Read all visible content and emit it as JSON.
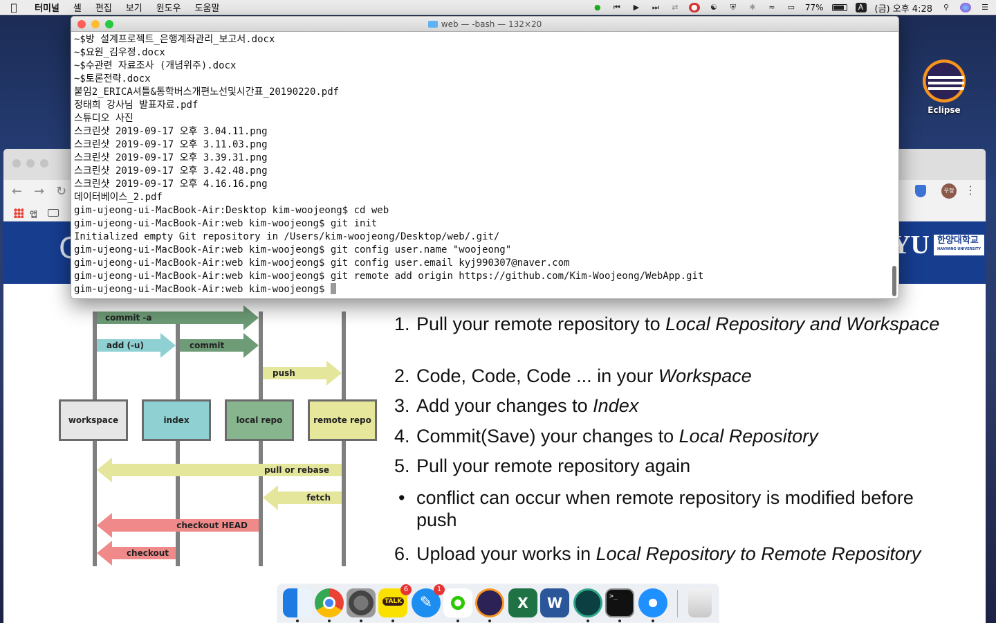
{
  "menubar": {
    "app_name": "터미널",
    "menus": [
      "셸",
      "편집",
      "보기",
      "윈도우",
      "도움말"
    ],
    "battery_percent": "77%",
    "input_source": "A",
    "clock": "(금) 오후 4:28"
  },
  "desktop": {
    "eclipse_label": "Eclipse"
  },
  "browser": {
    "bookmarks_apps_label": "앱",
    "avatar_text": "우정",
    "logo_letters": "YU",
    "logo_korean": "한양대학교",
    "logo_english": "HANYANG UNIVERSITY",
    "slide_title_fragment": "G"
  },
  "diagram": {
    "arrows": {
      "commit_a": "commit -a",
      "add_u": "add (-u)",
      "commit": "commit",
      "push": "push",
      "pull_or_rebase": "pull or rebase",
      "fetch": "fetch",
      "checkout_head": "checkout HEAD",
      "checkout": "checkout"
    },
    "boxes": {
      "workspace": "workspace",
      "index": "index",
      "local_repo": "local repo",
      "remote_repo": "remote repo"
    },
    "colors": {
      "workspace": "#e6e6e6",
      "index": "#8fd0d3",
      "local_repo": "#86b58e",
      "remote_repo": "#e6e79a",
      "green_arrow": "#6e9c77",
      "cyan_arrow": "#8fd0d3",
      "yellow_arrow": "#e4e69c",
      "red_arrow": "#f08a8a"
    }
  },
  "steps": [
    {
      "num": "1.",
      "plain": "Pull your remote repository to ",
      "italic": "Local Repository and Workspace"
    },
    {
      "num": "2.",
      "plain": "Code, Code, Code ... in your ",
      "italic": "Workspace"
    },
    {
      "num": "3.",
      "plain": "Add your changes to ",
      "italic": "Index"
    },
    {
      "num": "4.",
      "plain": "Commit(Save) your changes to ",
      "italic": "Local Repository"
    },
    {
      "num": "5.",
      "plain": "Pull your remote repository again",
      "italic": ""
    },
    {
      "num": "•",
      "plain": "conflict can occur when remote repository is modified before push",
      "italic": ""
    },
    {
      "num": "6.",
      "plain": "Upload your works in ",
      "italic": "Local Repository to Remote Repository"
    }
  ],
  "terminal": {
    "title": "web — -bash — 132×20",
    "lines": [
      "~$방 설계프로젝트_은행계좌관리_보고서.docx",
      "~$요원_김우정.docx",
      "~$수관련 자료조사 (개념위주).docx",
      "~$토론전략.docx",
      "붙임2_ERICA셔틀&통학버스개편노선및시간표_20190220.pdf",
      "정태희 강사님 발표자료.pdf",
      "스튜디오 사진",
      "스크린샷 2019-09-17 오후 3.04.11.png",
      "스크린샷 2019-09-17 오후 3.11.03.png",
      "스크린샷 2019-09-17 오후 3.39.31.png",
      "스크린샷 2019-09-17 오후 3.42.48.png",
      "스크린샷 2019-09-17 오후 4.16.16.png",
      "데이터베이스_2.pdf",
      "gim-ujeong-ui-MacBook-Air:Desktop kim-woojeong$ cd web",
      "gim-ujeong-ui-MacBook-Air:web kim-woojeong$ git init",
      "Initialized empty Git repository in /Users/kim-woojeong/Desktop/web/.git/",
      "gim-ujeong-ui-MacBook-Air:web kim-woojeong$ git config user.name \"woojeong\"",
      "gim-ujeong-ui-MacBook-Air:web kim-woojeong$ git config user.email kyj990307@naver.com",
      "gim-ujeong-ui-MacBook-Air:web kim-woojeong$ git remote add origin https://github.com/Kim-Woojeong/WebApp.git",
      "gim-ujeong-ui-MacBook-Air:web kim-woojeong$ "
    ]
  },
  "dock": {
    "apps": [
      "finder-icon",
      "chrome-icon",
      "system-preferences-icon",
      "kakaotalk-icon",
      "app-store-icon",
      "line-icon",
      "eclipse-icon",
      "excel-icon",
      "word-icon",
      "gitkraken-icon",
      "terminal-icon",
      "safari-icon",
      "trash-icon"
    ],
    "kakaotalk_label": "TALK",
    "kakaotalk_badge": "6",
    "appstore_badge": "1",
    "excel_letter": "X",
    "word_letter": "W",
    "terminal_prompt": ">_"
  }
}
